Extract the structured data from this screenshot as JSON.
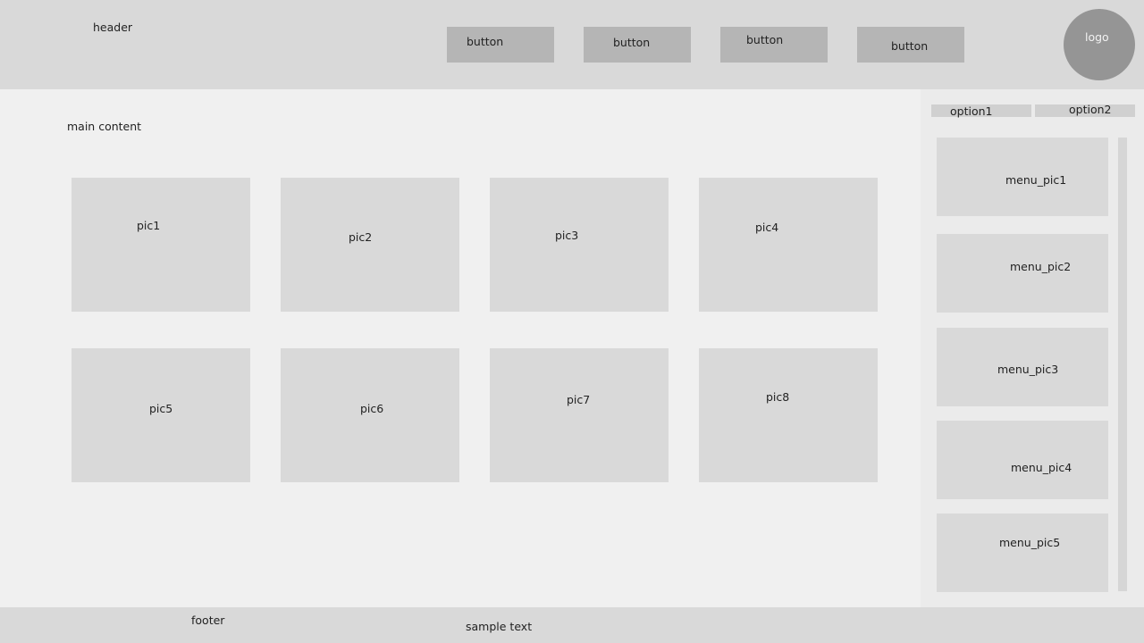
{
  "header": {
    "title": "header",
    "buttons": [
      "button",
      "button",
      "button",
      "button"
    ],
    "logo": "logo"
  },
  "main": {
    "title": "main content",
    "pics": [
      "pic1",
      "pic2",
      "pic3",
      "pic4",
      "pic5",
      "pic6",
      "pic7",
      "pic8"
    ]
  },
  "sidebar": {
    "options": [
      "option1",
      "option2"
    ],
    "menu_pics": [
      "menu_pic1",
      "menu_pic2",
      "menu_pic3",
      "menu_pic4",
      "menu_pic5"
    ]
  },
  "footer": {
    "title": "footer",
    "text": "sample text"
  }
}
